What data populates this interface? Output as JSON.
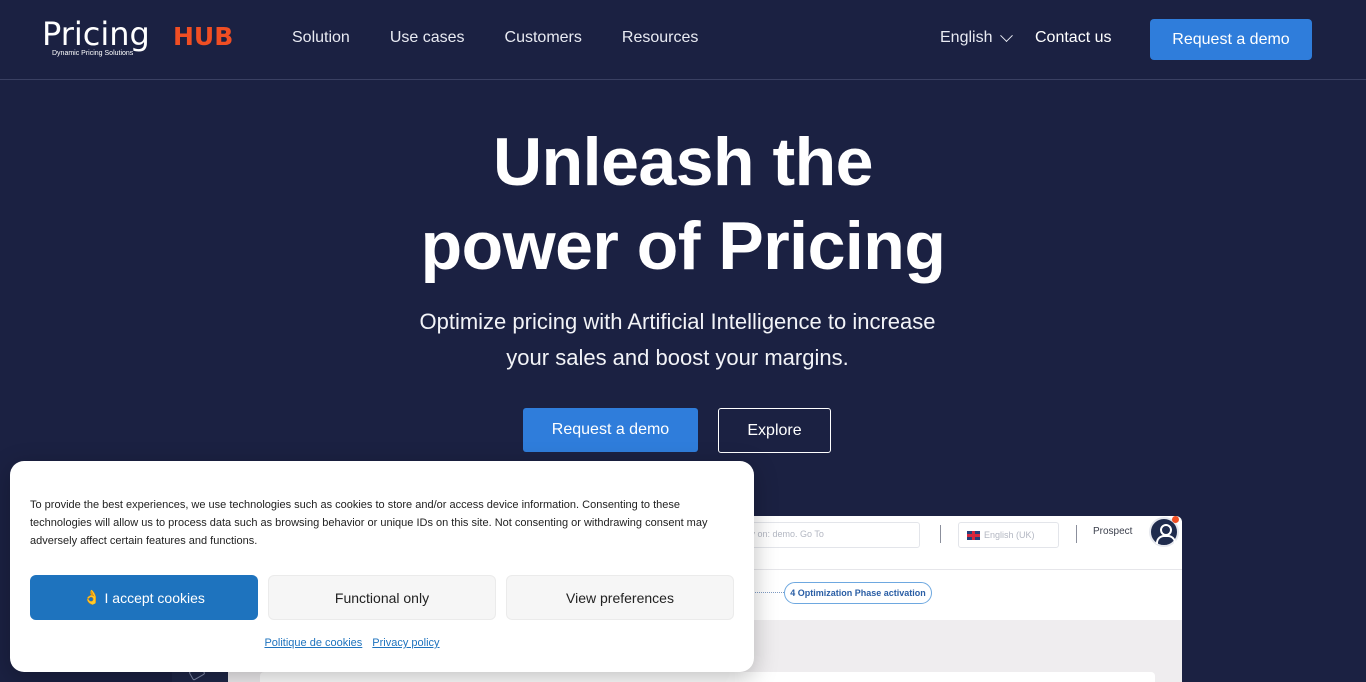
{
  "header": {
    "logo": {
      "main": "Pricing",
      "hub": "HUB",
      "tagline": "Dynamic Pricing Solutions"
    },
    "nav": [
      "Solution",
      "Use cases",
      "Customers",
      "Resources"
    ],
    "language": "English",
    "contact": "Contact us",
    "cta": "Request a demo"
  },
  "hero": {
    "title_line1": "Unleash the",
    "title_line2": "power of Pricing",
    "subtitle_line1": "Optimize pricing with Artificial Intelligence to increase",
    "subtitle_line2": "your sales and boost your margins.",
    "primary_button": "Request a demo",
    "secondary_button": "Explore"
  },
  "preview": {
    "search_placeholder": "ntly on: demo. Go To",
    "language": "English (UK)",
    "role": "Prospect",
    "step": "4 Optimization Phase activation"
  },
  "cookie_banner": {
    "text": "To provide the best experiences, we use technologies such as cookies to store and/or access device information. Consenting to these technologies will allow us to process data such as browsing behavior or unique IDs on this site. Not consenting or withdrawing consent may adversely affect certain features and functions.",
    "accept_emoji": "👌",
    "accept": "I accept cookies",
    "functional": "Functional only",
    "preferences": "View preferences",
    "cookie_policy": "Politique de cookies",
    "privacy_policy": "Privacy policy"
  },
  "colors": {
    "background": "#1b2142",
    "accent": "#2f7ddb",
    "brand_orange": "#f04e23",
    "cookie_accept": "#1e73be"
  }
}
